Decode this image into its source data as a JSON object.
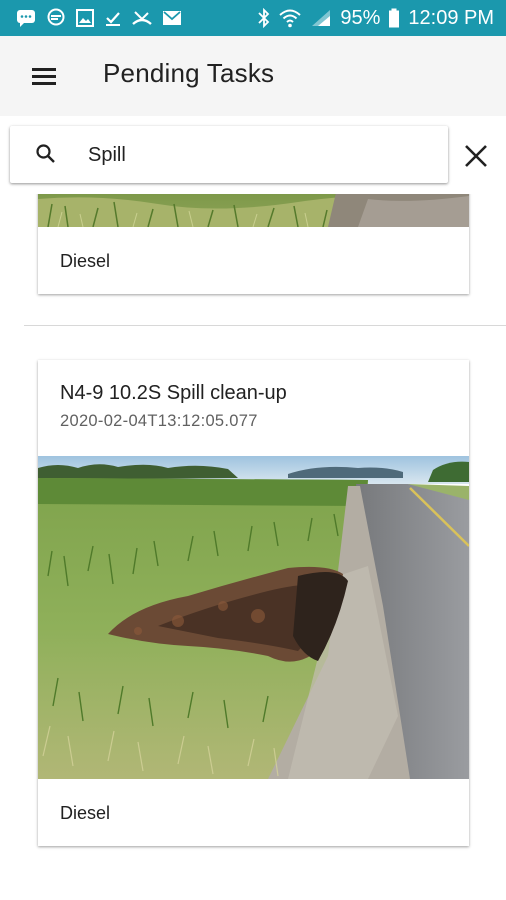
{
  "status_bar": {
    "battery": "95%",
    "time": "12:09 PM",
    "color": "#1b98ad"
  },
  "app_bar": {
    "title": "Pending Tasks"
  },
  "search": {
    "value": "Spill"
  },
  "tasks": [
    {
      "type": "Diesel"
    },
    {
      "title": "N4-9 10.2S Spill clean-up",
      "timestamp": "2020-02-04T13:12:05.077",
      "type": "Diesel"
    }
  ]
}
